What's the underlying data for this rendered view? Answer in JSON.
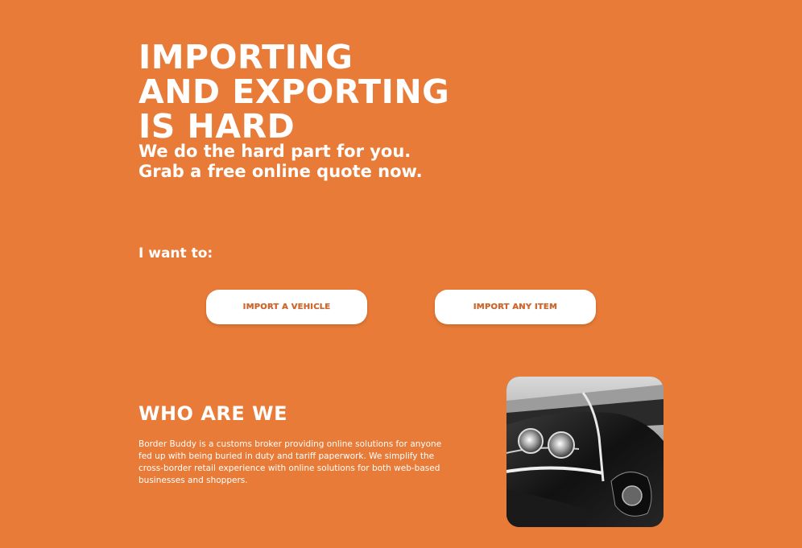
{
  "hero": {
    "title_lines": [
      "IMPORTING",
      "AND EXPORTING",
      "IS HARD"
    ],
    "subtitle_lines": [
      "We do the hard part for you.",
      "Grab a free online quote now."
    ]
  },
  "chooser": {
    "label": "I want to:",
    "import_vehicle": "IMPORT A VEHICLE",
    "import_item": "IMPORT ANY ITEM"
  },
  "about": {
    "title": "WHO ARE WE",
    "body": "Border Buddy is a customs broker providing online solutions for anyone fed up with being buried in duty and tariff paperwork. We simplify the cross-border retail experience with online solutions for both web-based businesses and shoppers."
  },
  "colors": {
    "background": "#e97b38",
    "button": "#ffffff",
    "button_text": "#d4682a"
  }
}
